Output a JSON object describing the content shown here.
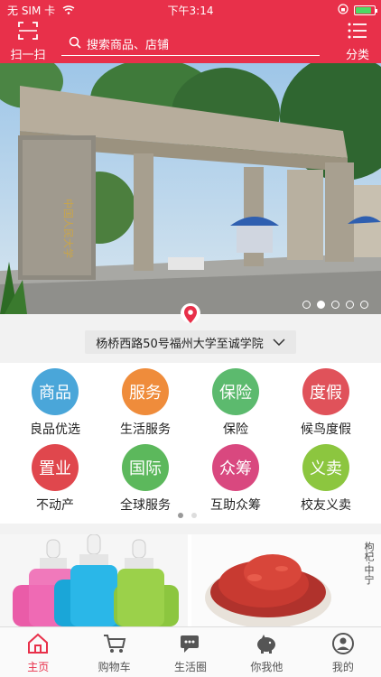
{
  "status_bar": {
    "carrier": "无 SIM 卡",
    "time": "下午3:14",
    "battery_level": 0.85
  },
  "header": {
    "scan_label": "扫一扫",
    "search_placeholder": "搜索商品、店铺",
    "category_label": "分类"
  },
  "banner": {
    "slide_count": 5,
    "active_slide": 2
  },
  "location": {
    "address": "杨桥西路50号福州大学至诚学院"
  },
  "services": [
    {
      "icon_text": "商品",
      "label": "良品优选",
      "color": "#4aa6d9"
    },
    {
      "icon_text": "服务",
      "label": "生活服务",
      "color": "#ef8c3b"
    },
    {
      "icon_text": "保险",
      "label": "保险",
      "color": "#5cba6e"
    },
    {
      "icon_text": "度假",
      "label": "候鸟度假",
      "color": "#e0525a"
    },
    {
      "icon_text": "置业",
      "label": "不动产",
      "color": "#e0474d"
    },
    {
      "icon_text": "国际",
      "label": "全球服务",
      "color": "#5cb85c"
    },
    {
      "icon_text": "众筹",
      "label": "互助众筹",
      "color": "#d9487f"
    },
    {
      "icon_text": "义卖",
      "label": "校友义卖",
      "color": "#8cc63f"
    }
  ],
  "products": {
    "goji_caption": "枸杞·中宁"
  },
  "tabbar": {
    "items": [
      {
        "label": "主页",
        "icon": "home-icon",
        "active": true
      },
      {
        "label": "购物车",
        "icon": "cart-icon",
        "active": false
      },
      {
        "label": "生活圈",
        "icon": "chat-icon",
        "active": false
      },
      {
        "label": "你我他",
        "icon": "piggy-bank-icon",
        "active": false
      },
      {
        "label": "我的",
        "icon": "user-icon",
        "active": false
      }
    ]
  }
}
